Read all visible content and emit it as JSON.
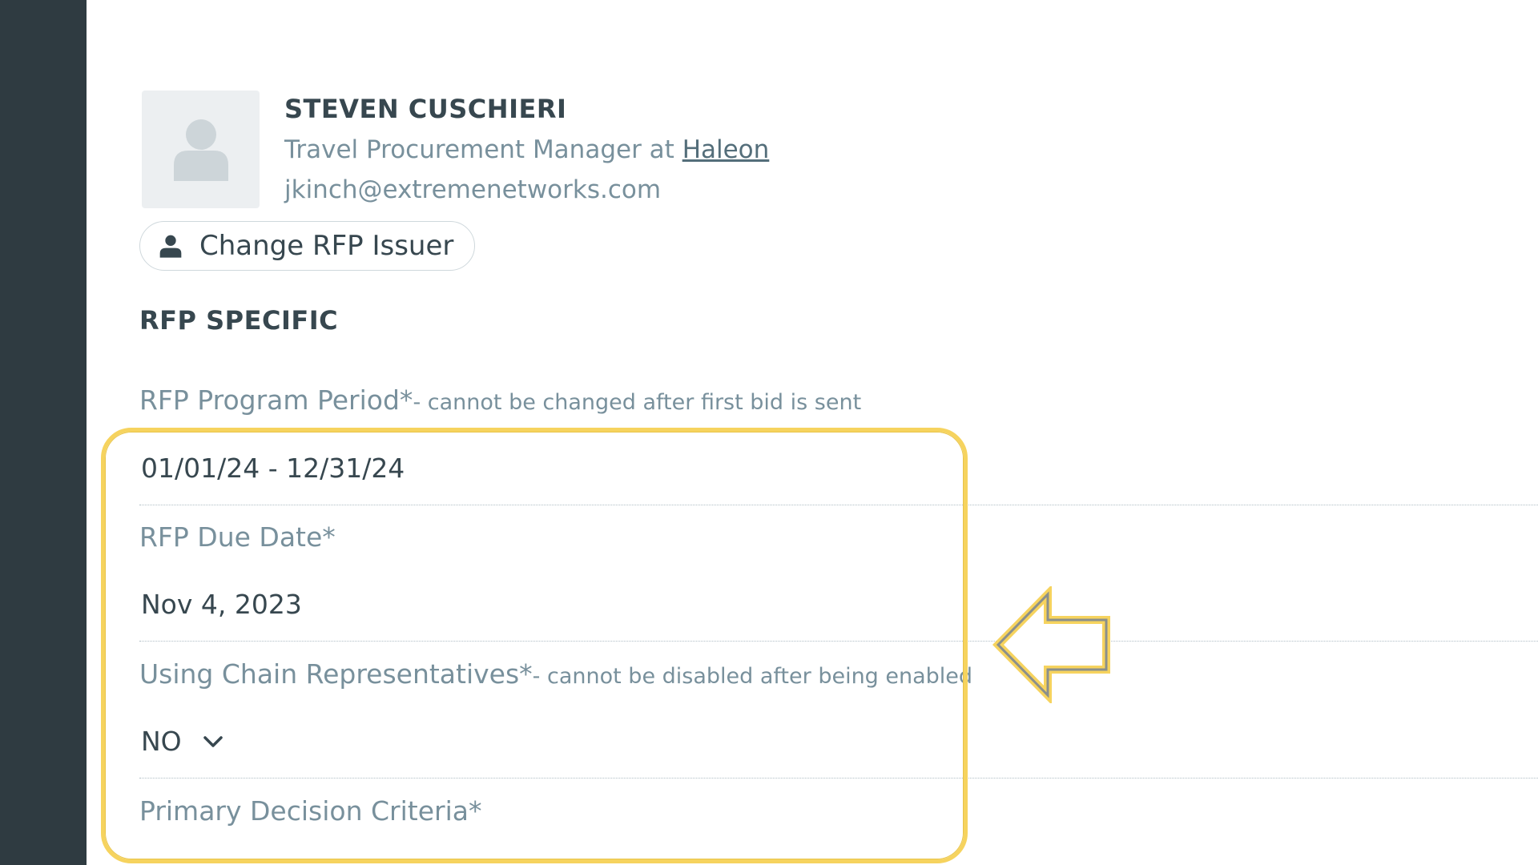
{
  "issuer": {
    "name": "STEVEN CUSCHIERI",
    "title_prefix": "Travel Procurement Manager at",
    "company": "Haleon",
    "email": "jkinch@extremenetworks.com",
    "change_button_label": "Change RFP Issuer"
  },
  "rfp_specific": {
    "heading": "RFP SPECIFIC",
    "program_period": {
      "label": "RFP Program Period*",
      "note": "- cannot be changed after first bid is sent",
      "value": "01/01/24 - 12/31/24"
    },
    "due_date": {
      "label": "RFP Due Date*",
      "value": "Nov 4, 2023"
    },
    "chain_reps": {
      "label": "Using Chain Representatives*",
      "note": "- cannot be disabled after being enabled",
      "value": "NO"
    },
    "decision_criteria": {
      "label": "Primary Decision Criteria*"
    }
  },
  "colors": {
    "rail": "#2f3b41",
    "highlight": "#f6d35e",
    "text_dark": "#37474f",
    "text_muted": "#78909c"
  },
  "icons": {
    "avatar": "user-placeholder-icon",
    "change_issuer": "person-icon",
    "dropdown": "chevron-down-icon",
    "callout": "left-arrow-icon"
  }
}
